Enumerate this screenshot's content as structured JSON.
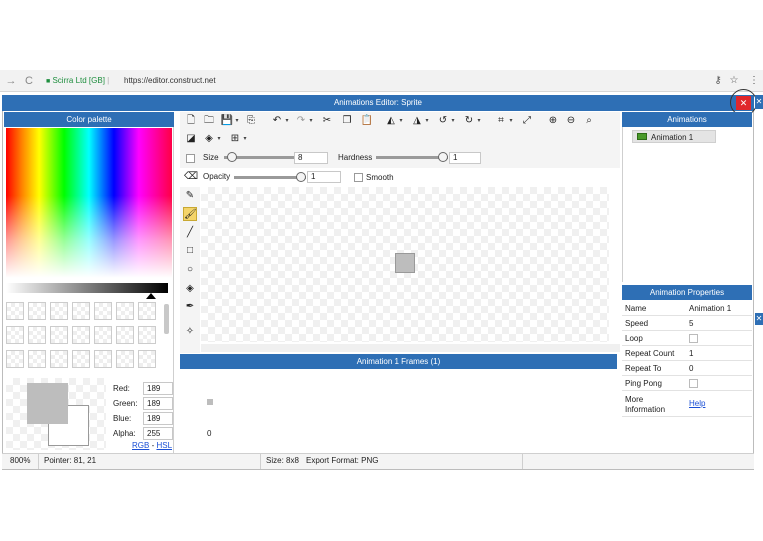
{
  "browser": {
    "secure_label": "Scirra Ltd [GB]",
    "separator": "|",
    "url": "https://editor.construct.net"
  },
  "window": {
    "title": "Animations Editor: Sprite",
    "close_glyph": "✕",
    "outer_close_glyph": "✕"
  },
  "palette": {
    "title": "Color palette",
    "red_label": "Red:",
    "red": "189",
    "green_label": "Green:",
    "green": "189",
    "blue_label": "Blue:",
    "blue": "189",
    "alpha_label": "Alpha:",
    "alpha": "255",
    "rgb_link": "RGB",
    "mode_sep": " - ",
    "hsl_link": "HSL",
    "primary_color": "#bdbdbd",
    "secondary_color": "#ffffff"
  },
  "toolbar": {
    "size_label": "Size",
    "size_value": "8",
    "size_fraction": 0.05,
    "hardness_label": "Hardness",
    "hardness_value": "1",
    "hardness_fraction": 1.0,
    "opacity_label": "Opacity",
    "opacity_value": "1",
    "opacity_fraction": 1.0,
    "smooth_label": "Smooth"
  },
  "frames": {
    "title": "Animation 1 Frames (1)",
    "frame_index": "0"
  },
  "animations": {
    "title": "Animations",
    "items": [
      "Animation 1"
    ]
  },
  "properties": {
    "title": "Animation Properties",
    "rows": [
      {
        "name": "Name",
        "value": "Animation 1"
      },
      {
        "name": "Speed",
        "value": "5"
      },
      {
        "name": "Loop",
        "value": ""
      },
      {
        "name": "Repeat Count",
        "value": "1"
      },
      {
        "name": "Repeat To",
        "value": "0"
      },
      {
        "name": "Ping Pong",
        "value": ""
      }
    ],
    "more_name": "More Information",
    "help_link": "Help"
  },
  "status": {
    "zoom": "800%",
    "pointer": "Pointer: 81, 21",
    "size": "Size: 8x8",
    "format": "Export Format: PNG"
  },
  "icons": {
    "back": "→",
    "reload": "C",
    "lock": "🔒",
    "key": "⚷",
    "star": "☆",
    "menu": "⋮",
    "new": "🗋",
    "open": "🗀",
    "save": "💾",
    "copy-file": "⎘",
    "undo": "↶",
    "redo": "↷",
    "cut": "✂",
    "copy": "❐",
    "paste": "📋",
    "flip-h": "◭",
    "flip-v": "◮",
    "rotate-ccw": "↺",
    "rotate-cw": "↻",
    "crop": "⌗",
    "resize": "⤢",
    "zoom-in": "⊕",
    "zoom-out": "⊖",
    "zoom-fit": "⌕",
    "color-mode": "◪",
    "layers": "◈",
    "grid": "⊞",
    "brush-size": "□",
    "eraser": "⌫",
    "pencil": "✎",
    "brush": "🖌",
    "line": "╱",
    "rect": "□",
    "ellipse": "○",
    "fill": "◈",
    "picker": "✒",
    "hotspot": "✧",
    "caret": "▾"
  }
}
